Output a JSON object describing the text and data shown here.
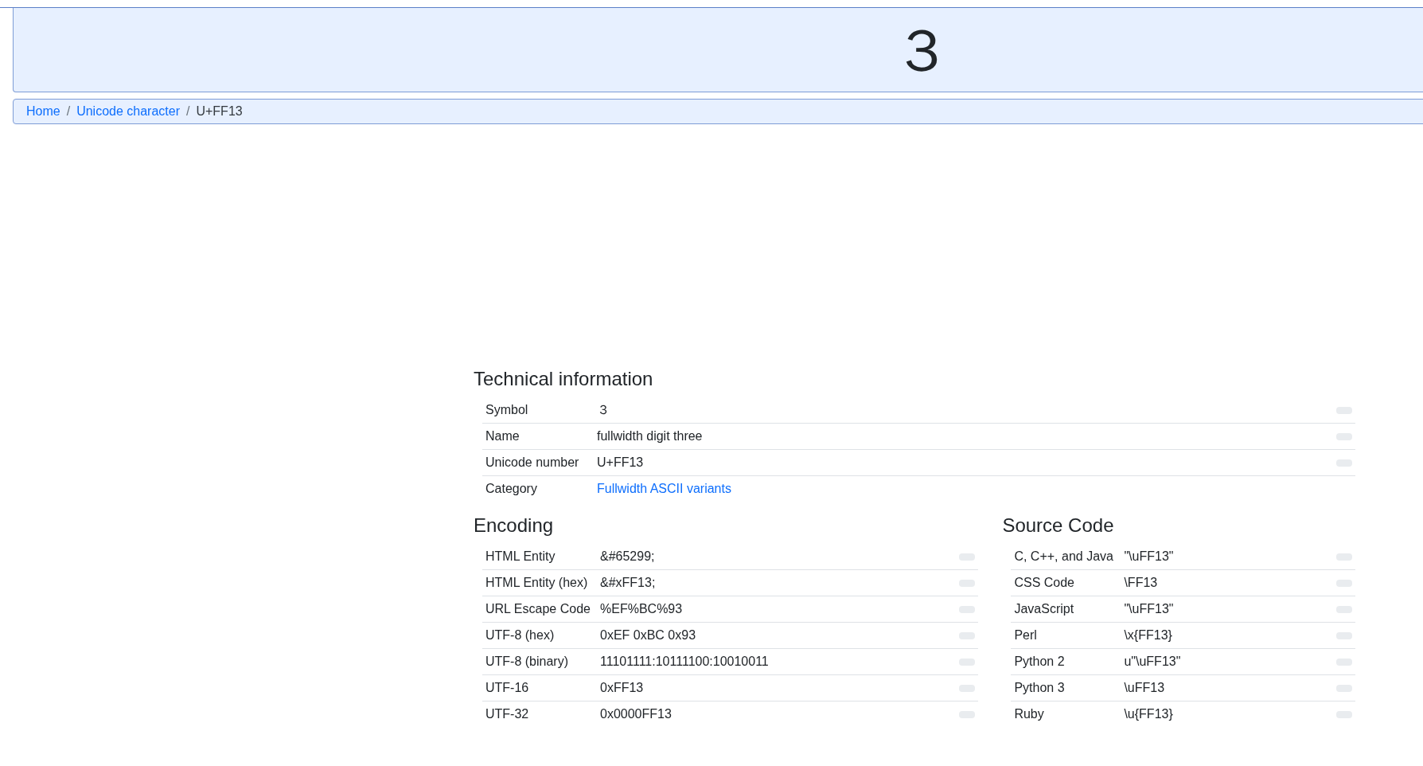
{
  "header": {
    "symbol": "３"
  },
  "breadcrumb": [
    {
      "label": "Home",
      "kind": "link"
    },
    {
      "label": "/",
      "kind": "separator"
    },
    {
      "label": "Unicode character",
      "kind": "link"
    },
    {
      "label": "/",
      "kind": "separator"
    },
    {
      "label": "U+FF13",
      "kind": "current"
    }
  ],
  "technical_information": {
    "title": "Technical information",
    "rows": [
      {
        "label": "Symbol",
        "value": "３",
        "kind": "text",
        "copy": true
      },
      {
        "label": "Name",
        "value": "fullwidth digit three",
        "kind": "text",
        "copy": true
      },
      {
        "label": "Unicode number",
        "value": "U+FF13",
        "kind": "text",
        "copy": true
      },
      {
        "label": "Category",
        "value": "Fullwidth ASCII variants",
        "kind": "link",
        "copy": false
      }
    ]
  },
  "encoding": {
    "title": "Encoding",
    "rows": [
      {
        "label": "HTML Entity",
        "value": "&#65299;",
        "copy": true
      },
      {
        "label": "HTML Entity (hex)",
        "value": "&#xFF13;",
        "copy": true
      },
      {
        "label": "URL Escape Code",
        "value": "%EF%BC%93",
        "copy": true
      },
      {
        "label": "UTF-8 (hex)",
        "value": "0xEF 0xBC 0x93",
        "copy": true
      },
      {
        "label": "UTF-8 (binary)",
        "value": "11101111:10111100:10010011",
        "copy": true
      },
      {
        "label": "UTF-16",
        "value": "0xFF13",
        "copy": true
      },
      {
        "label": "UTF-32",
        "value": "0x0000FF13",
        "copy": true
      }
    ]
  },
  "source_code": {
    "title": "Source Code",
    "rows": [
      {
        "label": "C, C++, and Java",
        "value": "\"\\uFF13\"",
        "copy": true
      },
      {
        "label": "CSS Code",
        "value": "\\FF13",
        "copy": true
      },
      {
        "label": "JavaScript",
        "value": "\"\\uFF13\"",
        "copy": true
      },
      {
        "label": "Perl",
        "value": "\\x{FF13}",
        "copy": true
      },
      {
        "label": "Python 2",
        "value": "u\"\\uFF13\"",
        "copy": true
      },
      {
        "label": "Python 3",
        "value": "\\uFF13",
        "copy": true
      },
      {
        "label": "Ruby",
        "value": "\\u{FF13}",
        "copy": true
      }
    ]
  }
}
